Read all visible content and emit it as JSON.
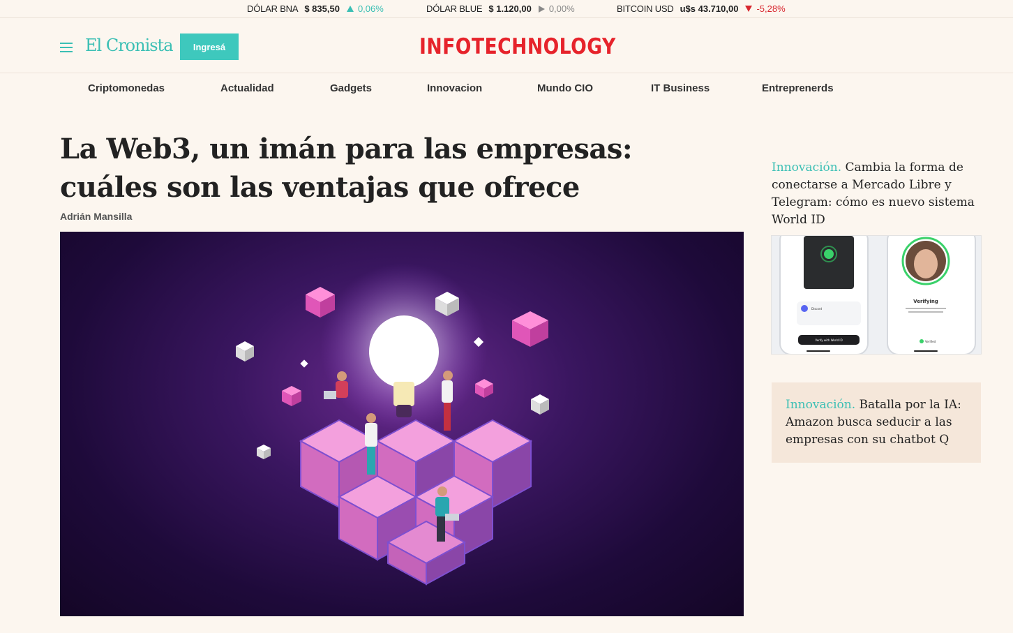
{
  "ticker": [
    {
      "name": "DÓLAR BNA",
      "value": "$ 835,50",
      "change": "0,06%",
      "direction": "up"
    },
    {
      "name": "DÓLAR BLUE",
      "value": "$ 1.120,00",
      "change": "0,00%",
      "direction": "flat"
    },
    {
      "name": "BITCOIN USD",
      "value": "u$s 43.710,00",
      "change": "-5,28%",
      "direction": "down"
    }
  ],
  "header": {
    "site_logo": "El Cronista",
    "login_label": "Ingresá",
    "brand_part1": "INFO",
    "brand_part2": "TECHNOLOGY"
  },
  "nav": {
    "items": [
      "Criptomonedas",
      "Actualidad",
      "Gadgets",
      "Innovacion",
      "Mundo CIO",
      "IT Business",
      "Entreprenerds"
    ]
  },
  "article": {
    "headline": "La Web3, un imán para las empresas: cuáles son las ventajas que ofrece",
    "author": "Adrián Mansilla"
  },
  "sidebar": {
    "items": [
      {
        "tag": "Innovación.",
        "title": " Cambia la forma de conectarse a Mercado Libre y Telegram: cómo es nuevo sistema World ID"
      },
      {
        "tag": "Innovación.",
        "title": " Batalla por la IA: Amazon busca seducir a las empresas con su chatbot Q"
      }
    ],
    "phone_labels": {
      "verifying": "Verifying",
      "app": "Discord",
      "button": "Verify with World ID",
      "verified": "Verified"
    }
  },
  "colors": {
    "accent": "#3bbfb4",
    "brand_red": "#e6232b",
    "background": "#fcf6ef",
    "down": "#d8262e"
  }
}
